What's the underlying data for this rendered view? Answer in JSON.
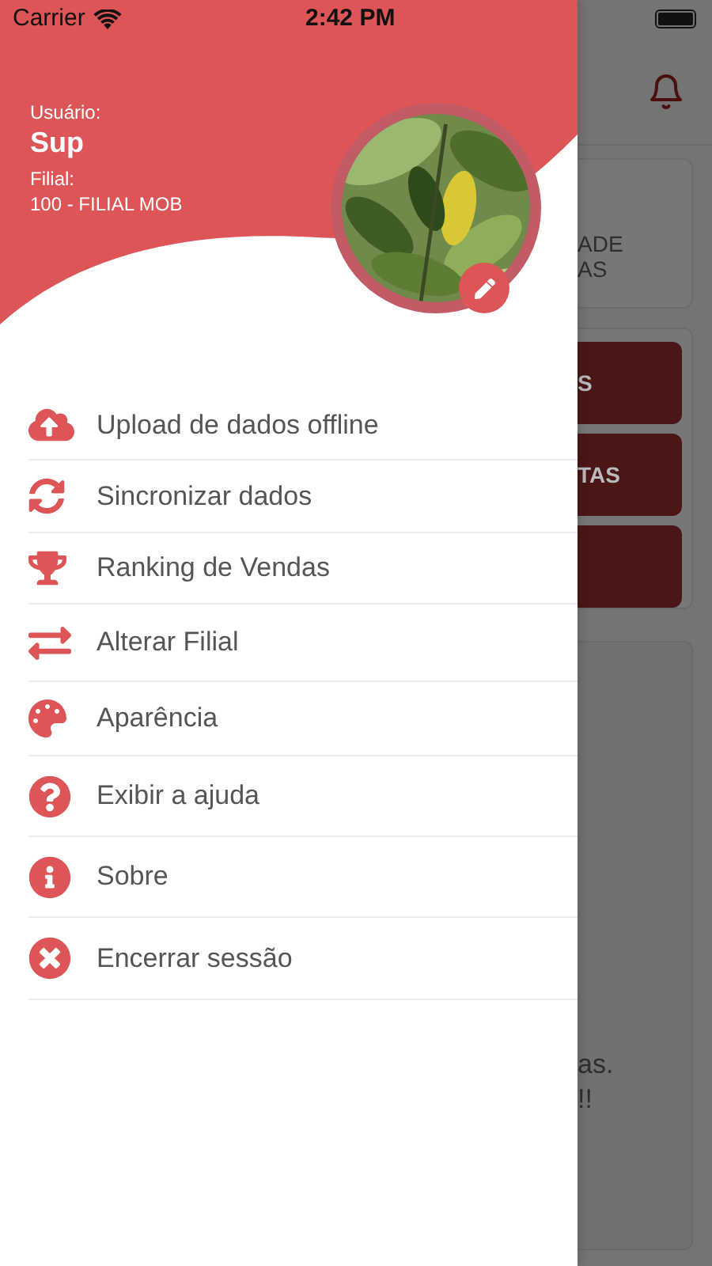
{
  "status_bar": {
    "carrier": "Carrier",
    "time": "2:42 PM"
  },
  "drawer": {
    "user_label": "Usuário:",
    "user_name": "Sup",
    "branch_label": "Filial:",
    "branch_value": "100 - FILIAL MOB",
    "menu": [
      {
        "label": "Upload de dados offline"
      },
      {
        "label": "Sincronizar dados"
      },
      {
        "label": "Ranking de Vendas"
      },
      {
        "label": "Alterar Filial"
      },
      {
        "label": "Aparência"
      },
      {
        "label": "Exibir a ajuda"
      },
      {
        "label": "Sobre"
      },
      {
        "label": "Encerrar sessão"
      }
    ]
  },
  "background_app": {
    "card_lines": [
      "ADE",
      "AS"
    ],
    "buttons": [
      {
        "kind": "labeled",
        "label": "S"
      },
      {
        "kind": "labeled",
        "label": "TAS"
      },
      {
        "kind": "blank"
      }
    ],
    "message_lines": [
      "as.",
      "!!"
    ]
  }
}
